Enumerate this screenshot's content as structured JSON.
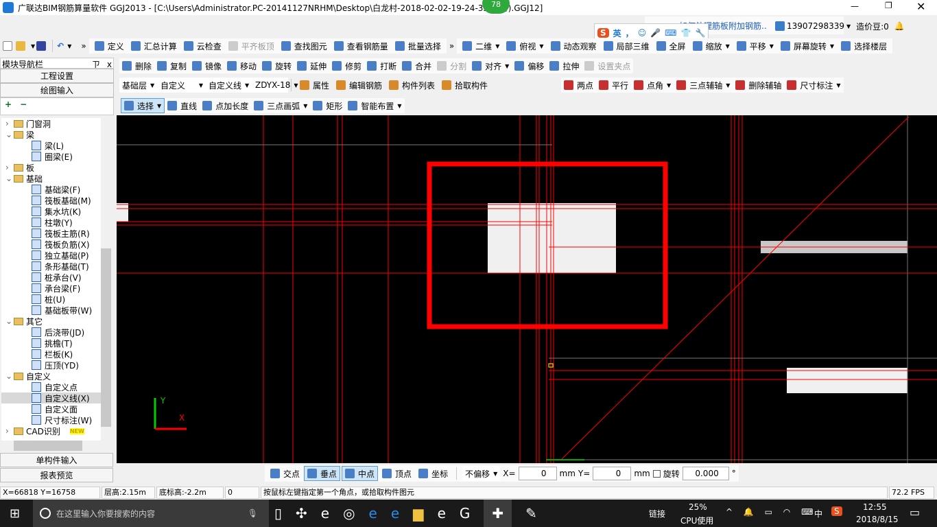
{
  "title": "广联达BIM钢筋算量软件 GGJ2013 - [C:\\Users\\Administrator.PC-20141127NRHM\\Desktop\\白龙村-2018-02-02-19-24-35(备份).GGJ12]",
  "badge": "78",
  "header": {
    "news": "如何处理筋板附加钢筋..",
    "phone": "13907298339",
    "beans": "造价豆:0"
  },
  "ime": {
    "lang": "英",
    "punct": "，"
  },
  "toolbar1": [
    "定义",
    "汇总计算",
    "云检查",
    "平齐板顶",
    "查找图元",
    "查看钢筋量",
    "批量选择"
  ],
  "toolbar1_disabled": [
    "平齐板顶"
  ],
  "view": [
    "二维",
    "俯视",
    "动态观察",
    "局部三维",
    "全屏",
    "缩放",
    "平移",
    "屏幕旋转",
    "选择楼层"
  ],
  "toolbar2": [
    "删除",
    "复制",
    "镜像",
    "移动",
    "旋转",
    "延伸",
    "修剪",
    "打断",
    "合并",
    "分割",
    "对齐",
    "偏移",
    "拉伸",
    "设置夹点"
  ],
  "selectors": {
    "floor": "基础层",
    "type": "自定义",
    "sub": "自定义线",
    "item": "ZDYX-18"
  },
  "toolbar3": [
    "属性",
    "编辑钢筋",
    "构件列表",
    "拾取构件"
  ],
  "axis_tools": [
    "两点",
    "平行",
    "点角",
    "三点辅轴",
    "删除辅轴",
    "尺寸标注"
  ],
  "draw_tools": [
    "选择",
    "直线",
    "点加长度",
    "三点画弧",
    "矩形",
    "智能布置"
  ],
  "nav": {
    "title": "模块导航栏",
    "pin": "ㄗ",
    "close": "x",
    "project": "工程设置",
    "draw": "绘图输入",
    "single": "单构件输入",
    "report": "报表预览"
  },
  "tree": [
    {
      "l": 0,
      "t": "门窗洞",
      "e": ">"
    },
    {
      "l": 0,
      "t": "梁",
      "e": "v"
    },
    {
      "l": 1,
      "t": "梁(L)"
    },
    {
      "l": 1,
      "t": "圈梁(E)"
    },
    {
      "l": 0,
      "t": "板",
      "e": ">"
    },
    {
      "l": 0,
      "t": "基础",
      "e": "v"
    },
    {
      "l": 1,
      "t": "基础梁(F)"
    },
    {
      "l": 1,
      "t": "筏板基础(M)"
    },
    {
      "l": 1,
      "t": "集水坑(K)"
    },
    {
      "l": 1,
      "t": "柱墩(Y)"
    },
    {
      "l": 1,
      "t": "筏板主筋(R)"
    },
    {
      "l": 1,
      "t": "筏板负筋(X)"
    },
    {
      "l": 1,
      "t": "独立基础(P)"
    },
    {
      "l": 1,
      "t": "条形基础(T)"
    },
    {
      "l": 1,
      "t": "桩承台(V)"
    },
    {
      "l": 1,
      "t": "承台梁(F)"
    },
    {
      "l": 1,
      "t": "桩(U)"
    },
    {
      "l": 1,
      "t": "基础板带(W)"
    },
    {
      "l": 0,
      "t": "其它",
      "e": "v"
    },
    {
      "l": 1,
      "t": "后浇带(JD)"
    },
    {
      "l": 1,
      "t": "挑檐(T)"
    },
    {
      "l": 1,
      "t": "栏板(K)"
    },
    {
      "l": 1,
      "t": "压顶(YD)"
    },
    {
      "l": 0,
      "t": "自定义",
      "e": "v"
    },
    {
      "l": 1,
      "t": "自定义点"
    },
    {
      "l": 1,
      "t": "自定义线(X)",
      "sel": true
    },
    {
      "l": 1,
      "t": "自定义面"
    },
    {
      "l": 1,
      "t": "尺寸标注(W)"
    },
    {
      "l": 0,
      "t": "CAD识别",
      "e": ">",
      "new": "NEW"
    }
  ],
  "axes": {
    "x": "X",
    "y": "Y"
  },
  "snap": {
    "items": [
      "交点",
      "垂点",
      "中点",
      "顶点",
      "坐标"
    ],
    "active": [
      "垂点",
      "中点"
    ],
    "offset": "不偏移",
    "x_label": "X=",
    "x": "0",
    "y_label": "Y=",
    "y": "0",
    "unit": "mm",
    "rotate_label": "旋转",
    "rotate": "0.000",
    "deg": "°"
  },
  "status": {
    "coords": "X=66818 Y=16758",
    "floor_h": "层高:2.15m",
    "base_h": "底标高:-2.2m",
    "zero": "0",
    "hint": "按鼠标左键指定第一个角点，或拾取构件图元",
    "fps": "72.2 FPS"
  },
  "taskbar": {
    "search": "在这里输入你要搜索的内容",
    "link": "链接",
    "cpu": "25%",
    "cpu_label": "CPU使用",
    "ime": "中",
    "time": "12:55",
    "date": "2018/8/15"
  },
  "colors": {
    "canvas": "#000000",
    "lines": "#ff0000",
    "accent": "#0078d7"
  }
}
